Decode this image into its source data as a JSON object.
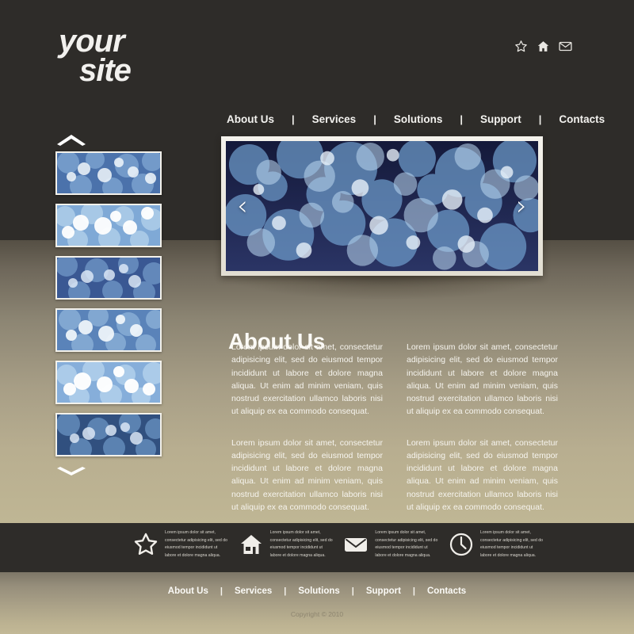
{
  "brand": {
    "line1": "your",
    "line2": "site"
  },
  "header": {
    "social_icons": [
      {
        "name": "star-icon",
        "label": "Favorites"
      },
      {
        "name": "home-icon",
        "label": "Home"
      },
      {
        "name": "mail-icon",
        "label": "Contact"
      }
    ]
  },
  "nav": {
    "separator": "|",
    "items": [
      {
        "label": "About Us"
      },
      {
        "label": "Services"
      },
      {
        "label": "Solutions"
      },
      {
        "label": "Support"
      },
      {
        "label": "Contacts"
      }
    ]
  },
  "slider": {
    "prev_label": "‹",
    "next_label": "›",
    "image_description": "blue bokeh circles on dark navy background"
  },
  "thumbnails": {
    "scroll_up": "chevron-up",
    "scroll_down": "chevron-down",
    "count": 6,
    "items": [
      {
        "tone": "mid"
      },
      {
        "tone": "light"
      },
      {
        "tone": "dark"
      },
      {
        "tone": "mid"
      },
      {
        "tone": "light"
      },
      {
        "tone": "dark"
      }
    ]
  },
  "about": {
    "title": "About Us",
    "paragraphs": [
      "Lorem ipsum dolor sit amet, consectetur adipisicing elit, sed do eiusmod tempor incididunt ut labore et dolore magna aliqua. Ut enim ad minim veniam, quis nostrud exercitation ullamco laboris nisi ut aliquip ex ea commodo consequat.",
      "Lorem ipsum dolor sit amet, consectetur adipisicing elit, sed do eiusmod tempor incididunt ut labore et dolore magna aliqua. Ut enim ad minim veniam, quis nostrud exercitation ullamco laboris nisi ut aliquip ex ea commodo consequat.",
      "Lorem ipsum dolor sit amet, consectetur adipisicing elit, sed do eiusmod tempor incididunt ut labore et dolore magna aliqua. Ut enim ad minim veniam, quis nostrud exercitation ullamco laboris nisi ut aliquip ex ea commodo consequat.",
      "Lorem ipsum dolor sit amet, consectetur adipisicing elit, sed do eiusmod tempor incididunt ut labore et dolore magna aliqua. Ut enim ad minim veniam, quis nostrud exercitation ullamco laboris nisi ut aliquip ex ea commodo consequat."
    ]
  },
  "features": [
    {
      "icon": "star-icon",
      "text": "Lorem ipsum dolor sit amet, consectetur adipisicing elit, sed do eiusmod tempor incididunt ut labore et dolore magna aliqua."
    },
    {
      "icon": "home-icon",
      "text": "Lorem ipsum dolor sit amet, consectetur adipisicing elit, sed do eiusmod tempor incididunt ut labore et dolore magna aliqua."
    },
    {
      "icon": "mail-icon",
      "text": "Lorem ipsum dolor sit amet, consectetur adipisicing elit, sed do eiusmod tempor incididunt ut labore et dolore magna aliqua."
    },
    {
      "icon": "clock-icon",
      "text": "Lorem ipsum dolor sit amet, consectetur adipisicing elit, sed do eiusmod tempor incididunt ut labore et dolore magna aliqua."
    }
  ],
  "footer": {
    "separator": "|",
    "nav": [
      {
        "label": "About Us"
      },
      {
        "label": "Services"
      },
      {
        "label": "Solutions"
      },
      {
        "label": "Support"
      },
      {
        "label": "Contacts"
      }
    ],
    "copyright": "Copyright © 2010"
  },
  "colors": {
    "dark": "#2e2c29",
    "tan": "#bfb694",
    "text_light": "#f6f4ee",
    "slide_navy": "#121a33",
    "frame": "#f4f2ec"
  }
}
